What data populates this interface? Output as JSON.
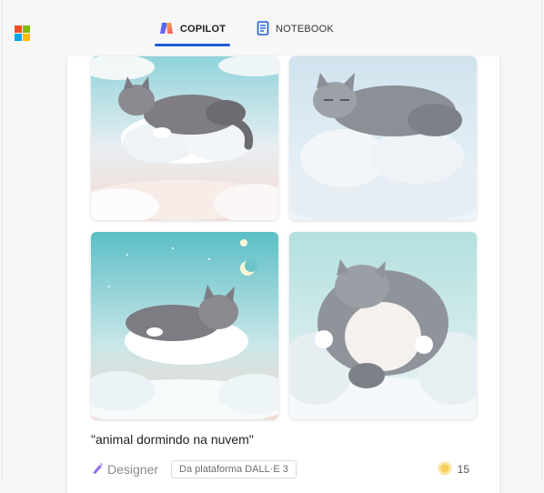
{
  "header": {
    "tabs": [
      {
        "label": "COPILOT",
        "active": true,
        "icon": "copilot-icon"
      },
      {
        "label": "NOTEBOOK",
        "active": false,
        "icon": "notebook-icon"
      }
    ],
    "accent_color": "#1f5bd6"
  },
  "logo": {
    "name": "microsoft-logo",
    "colors": [
      "#f25022",
      "#7fba00",
      "#00a4ef",
      "#ffb900"
    ]
  },
  "images": [
    {
      "subject": "gray tabby cat sleeping on cloud, sky background"
    },
    {
      "subject": "gray tabby cat sleeping on cloud, pale blue background"
    },
    {
      "subject": "gray tabby cat sleeping on cloud, starry night with moon"
    },
    {
      "subject": "chubby gray tabby cat sleeping on back on clouds"
    }
  ],
  "prompt_text": "\"animal dormindo na nuvem\"",
  "footer": {
    "designer_label": "Designer",
    "badge_label": "Da plataforma DALL·E 3",
    "reaction_count": "15"
  }
}
